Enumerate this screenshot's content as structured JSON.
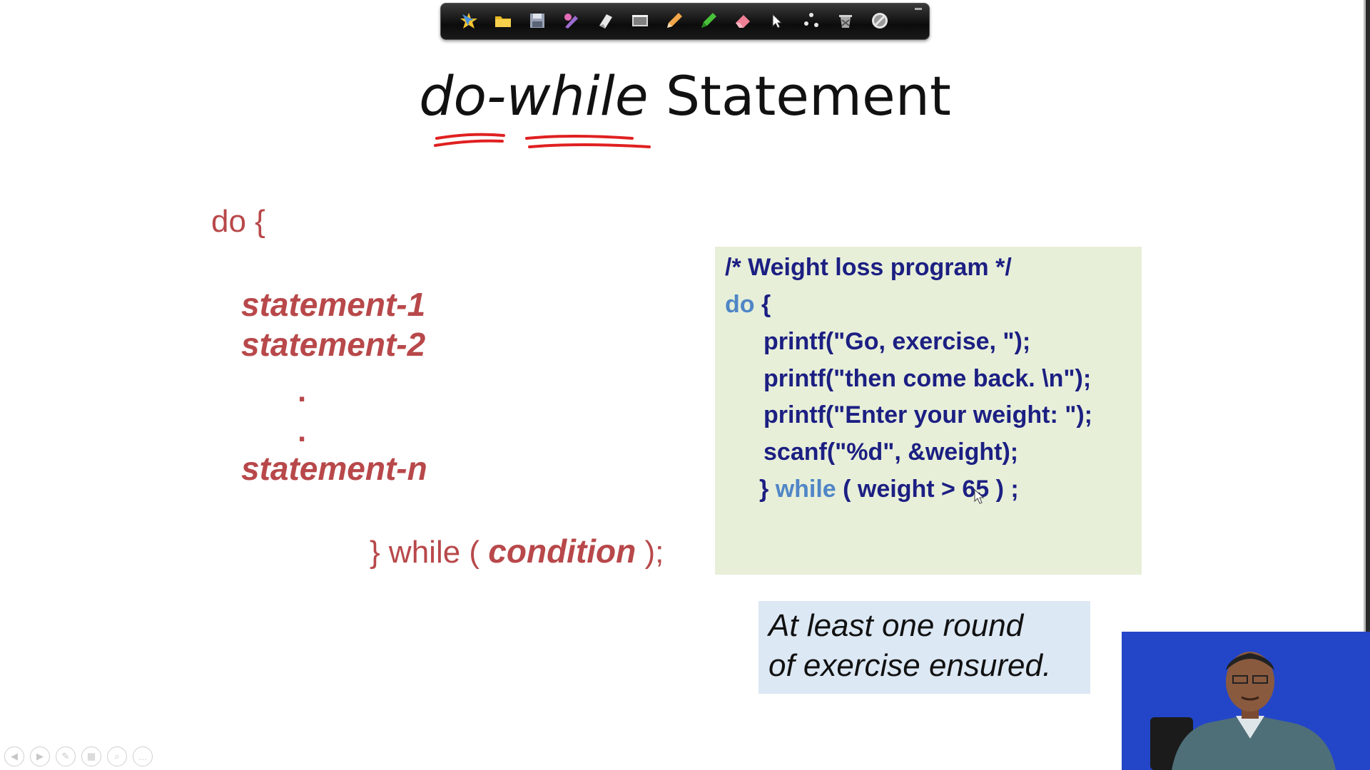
{
  "toolbar": {
    "tools": [
      "pointer-star-icon",
      "folder-icon",
      "save-icon",
      "pen-color-icon",
      "page-icon",
      "screen-icon",
      "pencil-icon",
      "highlighter-icon",
      "eraser-icon",
      "arrow-cursor-icon",
      "share-icon",
      "trash-icon",
      "stop-icon"
    ]
  },
  "slide": {
    "title_italic": "do-while",
    "title_rest": " Statement",
    "syntax": {
      "open": "do {",
      "stmt1": "statement-1",
      "stmt2": "statement-2",
      "dot": ".",
      "stmtn": "statement-n",
      "close_pre": "} while ( ",
      "condition": "condition",
      "close_post": " );"
    },
    "code": {
      "comment": "/* Weight loss program */",
      "do_kw": "do",
      "do_brace": " {",
      "line1": "printf(\"Go, exercise, \");",
      "line2": "printf(\"then come back. \\n\");",
      "line3": "printf(\"Enter your weight: \");",
      "line4": "scanf(\"%d\", &weight);",
      "close_brace": "} ",
      "while_kw": "while",
      "while_rest": " ( weight > 65 ) ;"
    },
    "note": {
      "line1": "At least one round",
      "line2": "of exercise ensured."
    }
  },
  "colors": {
    "syntax": "#b8484a",
    "code_text": "#1c1f82",
    "keyword": "#4f86c6",
    "code_bg": "#e7efd9",
    "note_bg": "#dce8f4",
    "ink": "#e02020"
  },
  "controls": [
    "previous-icon",
    "next-icon",
    "pen-icon",
    "slides-icon",
    "zoom-icon",
    "more-icon"
  ]
}
